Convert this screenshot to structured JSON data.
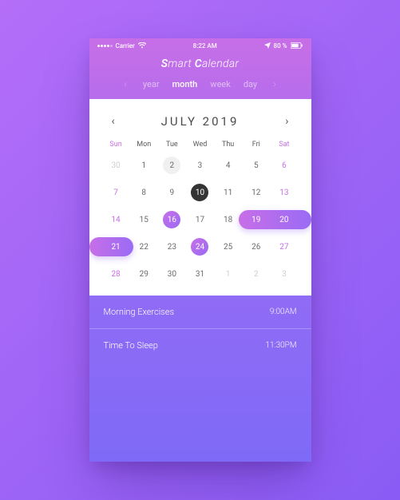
{
  "statusbar": {
    "carrier": "Carrier",
    "time": "8:22 AM",
    "battery": "80 %",
    "send_icon": "send-icon",
    "wifi_icon": "wifi-icon",
    "battery_icon": "battery-icon"
  },
  "app": {
    "title_prefix_cap": "S",
    "title_word1_rest": "mart ",
    "title_word2_cap": "C",
    "title_word2_rest": "alendar"
  },
  "tabs": {
    "items": [
      "year",
      "month",
      "week",
      "day"
    ],
    "active_index": 1
  },
  "calendar": {
    "month_label": "JULY 2019",
    "dow": [
      "Sun",
      "Mon",
      "Tue",
      "Wed",
      "Thu",
      "Fri",
      "Sat"
    ],
    "weeks": [
      [
        {
          "n": "30",
          "muted": true
        },
        {
          "n": "1"
        },
        {
          "n": "2",
          "ring": "gray"
        },
        {
          "n": "3"
        },
        {
          "n": "4"
        },
        {
          "n": "5"
        },
        {
          "n": "6",
          "weekend": true
        }
      ],
      [
        {
          "n": "7",
          "weekend": true
        },
        {
          "n": "8"
        },
        {
          "n": "9"
        },
        {
          "n": "10",
          "ring": "today"
        },
        {
          "n": "11"
        },
        {
          "n": "12"
        },
        {
          "n": "13",
          "weekend": true
        }
      ],
      [
        {
          "n": "14",
          "weekend": true
        },
        {
          "n": "15"
        },
        {
          "n": "16",
          "ring": "purple"
        },
        {
          "n": "17"
        },
        {
          "n": "18"
        },
        {
          "n": "19",
          "pill_start": true,
          "weekend_in_pill": true
        },
        {
          "n": "20",
          "weekend_in_pill": true
        }
      ],
      [
        {
          "n": "21",
          "pill_end": true,
          "weekend_in_pill": true
        },
        {
          "n": "22"
        },
        {
          "n": "23"
        },
        {
          "n": "24",
          "ring": "purple"
        },
        {
          "n": "25"
        },
        {
          "n": "26"
        },
        {
          "n": "27",
          "weekend": true
        }
      ],
      [
        {
          "n": "28",
          "weekend": true
        },
        {
          "n": "29"
        },
        {
          "n": "30"
        },
        {
          "n": "31"
        },
        {
          "n": "1",
          "muted": true
        },
        {
          "n": "2",
          "muted": true
        },
        {
          "n": "3",
          "muted": true
        }
      ]
    ]
  },
  "events": [
    {
      "title": "Morning Exercises",
      "time": "9:00AM"
    },
    {
      "title": "Time To Sleep",
      "time": "11:30PM"
    }
  ],
  "colors": {
    "accent_a": "#c76ee7",
    "accent_b": "#9a6cf5"
  }
}
